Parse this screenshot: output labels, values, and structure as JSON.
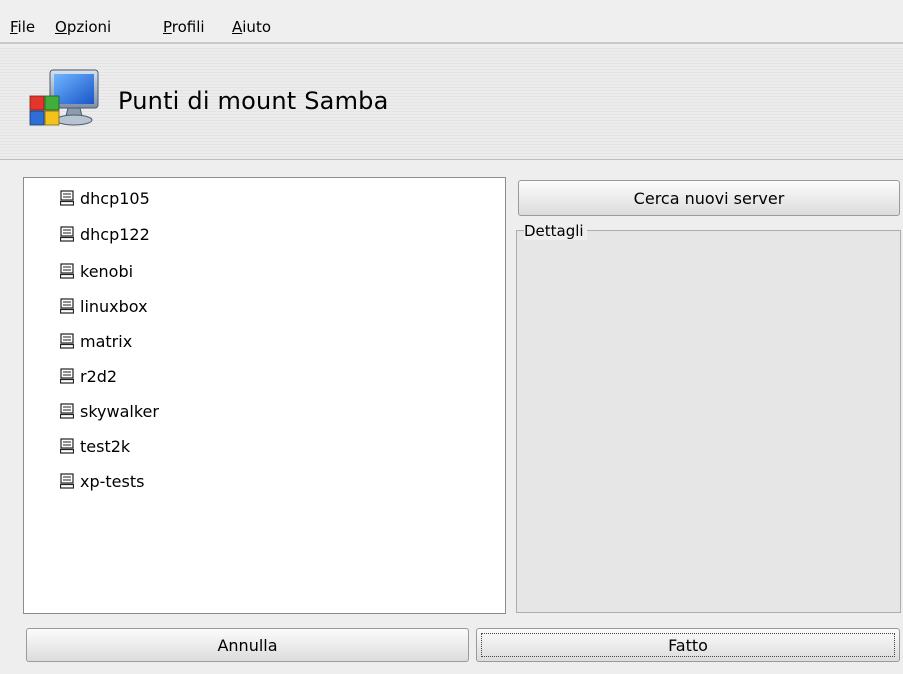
{
  "menu": [
    {
      "key": "F",
      "rest": "ile"
    },
    {
      "key": "O",
      "rest": "pzioni"
    },
    {
      "key": "P",
      "rest": "rofili"
    },
    {
      "key": "A",
      "rest": "iuto"
    }
  ],
  "banner": {
    "title": "Punti di mount Samba",
    "icon": "network-computer-icon"
  },
  "servers": [
    "dhcp105",
    "dhcp122",
    "kenobi",
    "linuxbox",
    "matrix",
    "r2d2",
    "skywalker",
    "test2k",
    "xp-tests"
  ],
  "buttons": {
    "search": "Cerca nuovi server",
    "cancel": "Annulla",
    "done": "Fatto"
  },
  "details": {
    "legend": "Dettagli"
  }
}
